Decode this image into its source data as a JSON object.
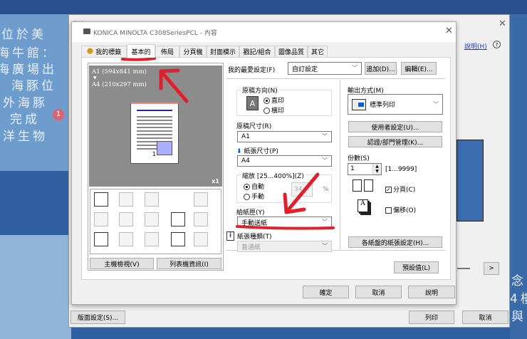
{
  "background": {
    "lines": [
      "位於美",
      "海牛館：",
      "海廣場出",
      "海豚位",
      "外海豚",
      "完成",
      "洋生物"
    ],
    "badge": "1",
    "right_lines": [
      "念",
      "4樓",
      "與"
    ]
  },
  "print_dialog": {
    "title": "列印",
    "help_link": "說明(H)",
    "help_icon": "?",
    "next_button": ">",
    "page_setup_button": "版面設定(S)...",
    "print_button": "列印",
    "cancel_button": "取消"
  },
  "properties_dialog": {
    "title": "KONICA MINOLTA C308SeriesPCL - 內容",
    "tabs": [
      "我的標籤",
      "基本的",
      "佈局",
      "分頁機",
      "封面模示",
      "戳記/組合",
      "圖像品質",
      "其它"
    ],
    "active_tab": "基本的",
    "preview": {
      "original_size": "A1 (594x841 mm)",
      "arrow": "▼",
      "output_size": "A4 (210x297 mm)",
      "copies_badge": "x1",
      "page_number": "1"
    },
    "printer_view_button": "主機檢視(V)",
    "printer_info_button": "列表機資訊(I)",
    "favorite_label": "我的最愛設定(F)",
    "favorite_value": "自訂設定",
    "add_button": "追加(D)...",
    "edit_button": "編輯(E)...",
    "orientation": {
      "label": "原稿方向(N)",
      "icon": "A",
      "portrait": "直印",
      "landscape": "橫印",
      "selected": "直印"
    },
    "original_size": {
      "label": "原稿尺寸(R)",
      "value": "A1"
    },
    "paper_size": {
      "label": "紙張尺寸(P)",
      "value": "A4"
    },
    "zoom": {
      "label": "縮放 [25...400%](Z)",
      "auto": "自動",
      "manual": "手動",
      "selected": "自動",
      "value": "34",
      "unit": "%"
    },
    "paper_tray": {
      "label": "給紙匣(Y)",
      "value": "手動送紙"
    },
    "paper_type": {
      "label": "紙張種類(T)",
      "value": "普通紙",
      "info_icon": "i"
    },
    "output_method": {
      "label": "輸出方式(M)",
      "value": "標準列印"
    },
    "user_settings_button": "使用者設定(U)...",
    "auth_button": "認證/部門管理(K)...",
    "copies": {
      "label": "份數(S)",
      "value": "1",
      "range": "[1...9999]"
    },
    "collate": {
      "label": "分頁(C)",
      "checked": true
    },
    "offset": {
      "label": "偏移(O)",
      "checked": false
    },
    "tray_settings_button": "各紙盤的紙張設定(H)...",
    "defaults_button": "預設值(L)",
    "ok_button": "確定",
    "cancel_button": "取消",
    "help_button": "說明"
  },
  "colors": {
    "annotation": "#e0202c",
    "accent": "#0a5cd8"
  }
}
